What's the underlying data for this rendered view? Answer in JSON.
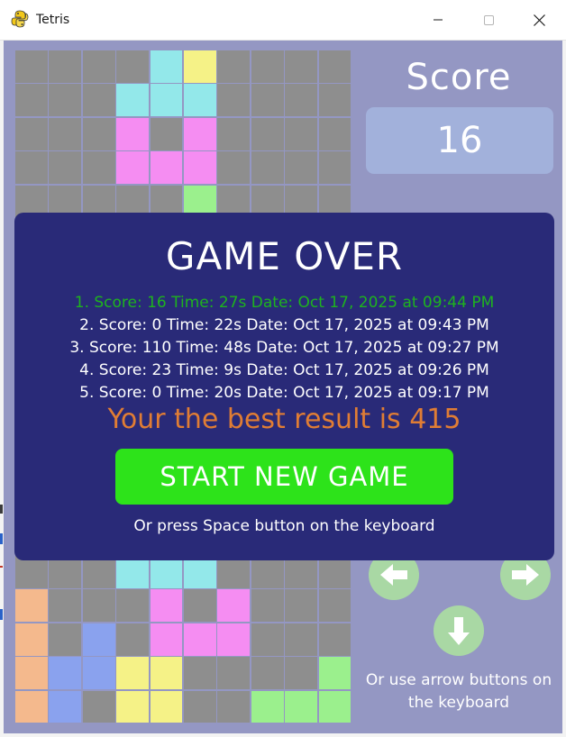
{
  "window": {
    "title": "Tetris",
    "buttons": [
      "minimize",
      "maximize",
      "close"
    ]
  },
  "colors": {
    "background": "#9497c3",
    "overlay": "#292a78",
    "current_result": "#1eb31e",
    "best_result": "#e07d34",
    "new_game_button": "#2de31a",
    "score_box": "#a2b1db",
    "control_button": "#a9d8a4",
    "pieces": {
      "I": "#93e8ea",
      "O": "#f5f287",
      "T": "#f58df2",
      "S": "#9bf08d",
      "L": "#f4b98d",
      "J": "#8aa2ee",
      "empty": "#8e8e8e"
    }
  },
  "score_panel": {
    "label": "Score",
    "value": "16"
  },
  "controls": {
    "left_icon": "arrow-left-icon",
    "right_icon": "arrow-right-icon",
    "down_icon": "arrow-down-icon",
    "hint": "Or use arrow buttons on the keyboard"
  },
  "game_over": {
    "title": "GAME OVER",
    "results": [
      "1. Score: 16 Time: 27s Date: Oct 17, 2025 at 09:44 PM",
      "2. Score: 0 Time: 22s Date: Oct 17, 2025 at 09:43 PM",
      "3. Score: 110 Time: 48s Date: Oct 17, 2025 at 09:27 PM",
      "4. Score: 23 Time: 9s Date: Oct 17, 2025 at 09:26 PM",
      "5. Score: 0 Time: 20s Date: Oct 17, 2025 at 09:17 PM"
    ],
    "best": "Your the best result is 415",
    "new_game_label": "START NEW GAME",
    "hint": "Or press Space button on the keyboard"
  },
  "board": {
    "cols": 10,
    "rows": 20,
    "top_rows": [
      "....IO....",
      "...III....",
      "...T.T....",
      "...TTT....",
      ".....S...."
    ],
    "bottom_rows": [
      "...III....",
      "L...T.T...",
      "L.J.TTT...",
      "LJJOO....S",
      "LJ.OO..SSS"
    ]
  }
}
